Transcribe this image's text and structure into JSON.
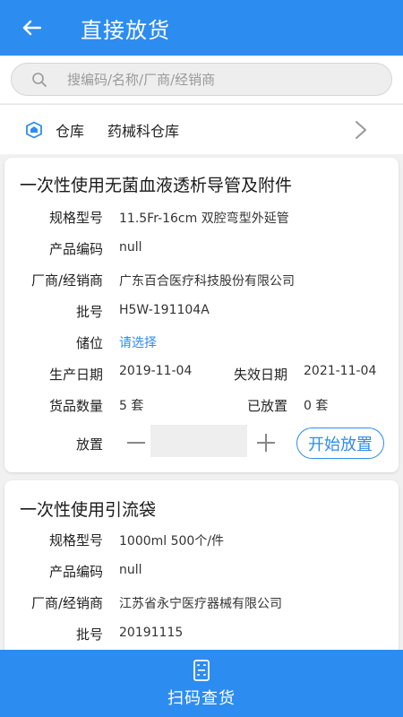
{
  "header": {
    "title": "直接放货"
  },
  "search": {
    "placeholder": "搜编码/名称/厂商/经销商"
  },
  "warehouse": {
    "label": "仓库",
    "value": "药械科仓库"
  },
  "items": [
    {
      "name": "一次性使用无菌血液透析导管及附件",
      "spec_label": "规格型号",
      "spec": "11.5Fr-16cm   双腔弯型外延管",
      "code_label": "产品编码",
      "code": "null",
      "maker_label": "厂商/经销商",
      "maker": "广东百合医疗科技股份有限公司",
      "batch_label": "批号",
      "batch": "H5W-191104A",
      "location_label": "储位",
      "location": "请选择",
      "prod_date_label": "生产日期",
      "prod_date": "2019-11-04",
      "exp_date_label": "失效日期",
      "exp_date": "2021-11-04",
      "qty_label": "货品数量",
      "qty": "5  套",
      "placed_label": "已放置",
      "placed": "0  套",
      "place_label": "放置",
      "start_button": "开始放置"
    },
    {
      "name": "一次性使用引流袋",
      "spec_label": "规格型号",
      "spec": "1000ml   500个/件",
      "code_label": "产品编码",
      "code": "null",
      "maker_label": "厂商/经销商",
      "maker": "江苏省永宁医疗器械有限公司",
      "batch_label": "批号",
      "batch": "20191115"
    }
  ],
  "bottom": {
    "scan_label": "扫码查货"
  },
  "colors": {
    "primary": "#2d8cf0",
    "background": "#f1f1f1"
  }
}
